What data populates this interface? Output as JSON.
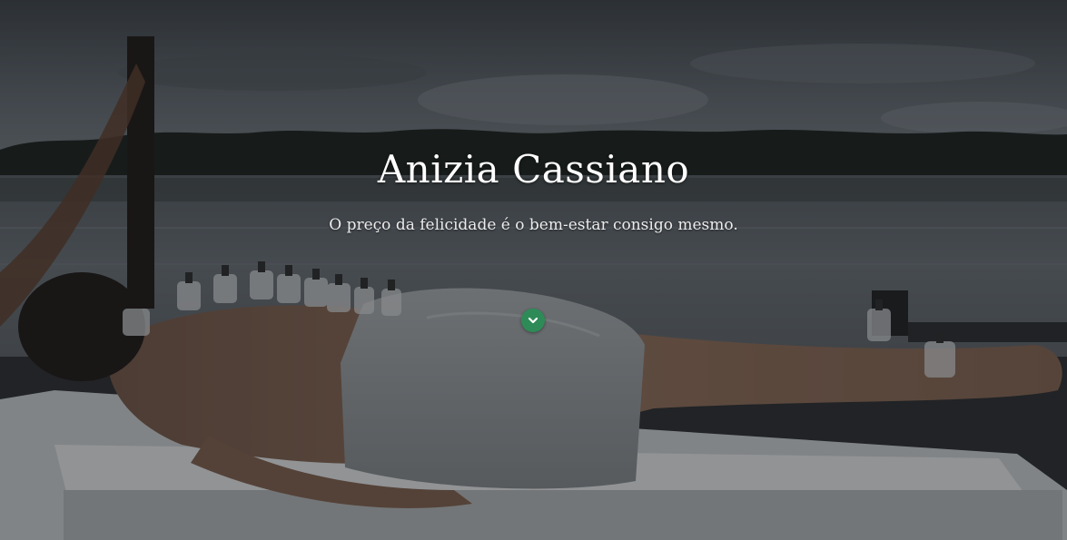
{
  "hero": {
    "title": "Anizia Cassiano",
    "subtitle": "O preço da felicidade é o bem-estar consigo mesmo.",
    "background_image": "massage-cupping-therapy-lakeside-photo",
    "scroll_icon": "chevron-down-icon"
  },
  "colors": {
    "accent": "#2e8b57",
    "title_text": "#ffffff",
    "subtitle_text": "#ececec"
  }
}
